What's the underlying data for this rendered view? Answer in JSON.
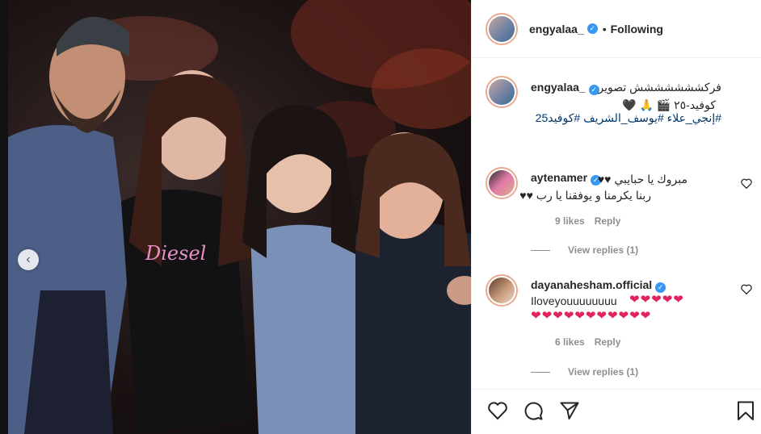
{
  "post": {
    "username": "engyalaa_",
    "verified_glyph": "✓",
    "separator": "•",
    "follow_status": "Following"
  },
  "caption": {
    "username": "engyalaa_",
    "line1": "فركششششششش تصوير",
    "line2": "كوفيد-٢٥ 🎬 🙏 🖤",
    "hashtags": "#إنجي_علاء #يوسف_الشريف #كوفيد25"
  },
  "comments": [
    {
      "username": "aytenamer",
      "line1": "مبروك يا حبايبي ♥♥",
      "line2": "ربنا يكرمنا و يوفقنا يا رب ♥♥",
      "likes": "9 likes",
      "reply_label": "Reply",
      "view_replies": "View replies (1)",
      "avatar_icon": "avatar-aytenamer"
    },
    {
      "username": "dayanahesham.official",
      "line1": "Iloveyouuuuuuuu",
      "hearts1": "❤❤❤❤❤",
      "hearts2": "❤❤❤❤❤❤❤❤❤❤❤",
      "likes": "6 likes",
      "reply_label": "Reply",
      "view_replies": "View replies (1)",
      "avatar_icon": "avatar-dayanahesham"
    }
  ],
  "icons": {
    "carousel_prev": "chevron-left-icon",
    "like": "heart-icon",
    "comment": "comment-bubble-icon",
    "share": "paper-plane-icon",
    "save": "bookmark-icon",
    "comment_like": "heart-outline-icon"
  },
  "colors": {
    "verified": "#3897f0",
    "hashtag": "#00376b",
    "heart_emoji": "#e0245e",
    "muted": "#8e8e8e"
  }
}
